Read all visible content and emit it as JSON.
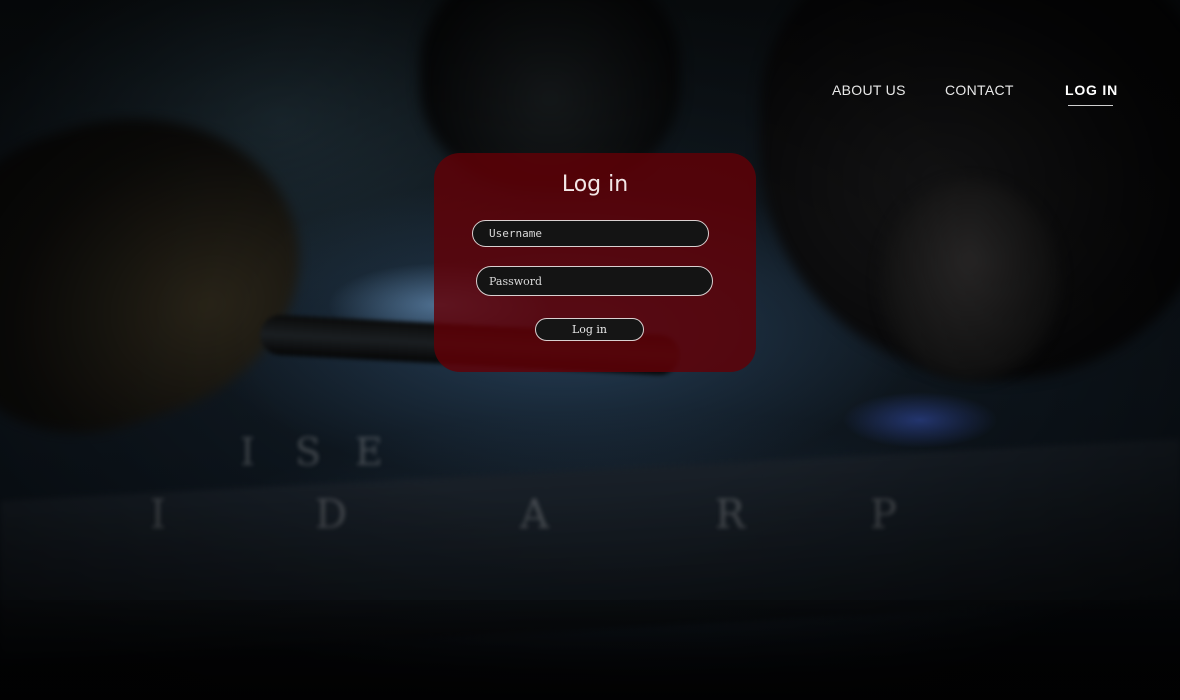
{
  "nav": {
    "items": [
      {
        "label": "ABOUT US"
      },
      {
        "label": "CONTACT"
      },
      {
        "label": "LOG IN",
        "active": true
      }
    ]
  },
  "login_form": {
    "title": "Log in",
    "username_placeholder": "Username",
    "password_placeholder": "Password",
    "submit_label": "Log in"
  },
  "colors": {
    "card_background": "#620006",
    "field_background": "#141414",
    "nav_text": "#e8e8e8"
  }
}
